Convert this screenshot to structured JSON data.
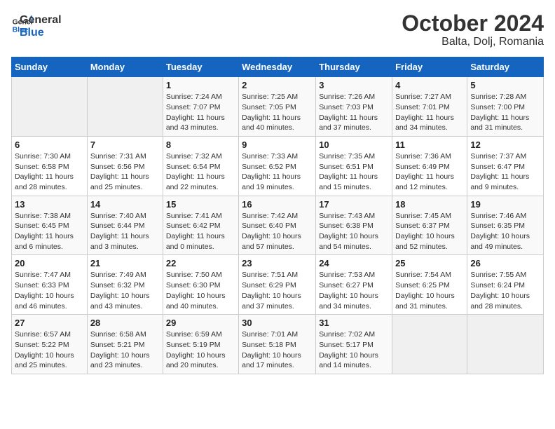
{
  "header": {
    "logo_line1": "General",
    "logo_line2": "Blue",
    "title": "October 2024",
    "subtitle": "Balta, Dolj, Romania"
  },
  "weekdays": [
    "Sunday",
    "Monday",
    "Tuesday",
    "Wednesday",
    "Thursday",
    "Friday",
    "Saturday"
  ],
  "weeks": [
    [
      {
        "day": "",
        "info": ""
      },
      {
        "day": "",
        "info": ""
      },
      {
        "day": "1",
        "info": "Sunrise: 7:24 AM\nSunset: 7:07 PM\nDaylight: 11 hours and 43 minutes."
      },
      {
        "day": "2",
        "info": "Sunrise: 7:25 AM\nSunset: 7:05 PM\nDaylight: 11 hours and 40 minutes."
      },
      {
        "day": "3",
        "info": "Sunrise: 7:26 AM\nSunset: 7:03 PM\nDaylight: 11 hours and 37 minutes."
      },
      {
        "day": "4",
        "info": "Sunrise: 7:27 AM\nSunset: 7:01 PM\nDaylight: 11 hours and 34 minutes."
      },
      {
        "day": "5",
        "info": "Sunrise: 7:28 AM\nSunset: 7:00 PM\nDaylight: 11 hours and 31 minutes."
      }
    ],
    [
      {
        "day": "6",
        "info": "Sunrise: 7:30 AM\nSunset: 6:58 PM\nDaylight: 11 hours and 28 minutes."
      },
      {
        "day": "7",
        "info": "Sunrise: 7:31 AM\nSunset: 6:56 PM\nDaylight: 11 hours and 25 minutes."
      },
      {
        "day": "8",
        "info": "Sunrise: 7:32 AM\nSunset: 6:54 PM\nDaylight: 11 hours and 22 minutes."
      },
      {
        "day": "9",
        "info": "Sunrise: 7:33 AM\nSunset: 6:52 PM\nDaylight: 11 hours and 19 minutes."
      },
      {
        "day": "10",
        "info": "Sunrise: 7:35 AM\nSunset: 6:51 PM\nDaylight: 11 hours and 15 minutes."
      },
      {
        "day": "11",
        "info": "Sunrise: 7:36 AM\nSunset: 6:49 PM\nDaylight: 11 hours and 12 minutes."
      },
      {
        "day": "12",
        "info": "Sunrise: 7:37 AM\nSunset: 6:47 PM\nDaylight: 11 hours and 9 minutes."
      }
    ],
    [
      {
        "day": "13",
        "info": "Sunrise: 7:38 AM\nSunset: 6:45 PM\nDaylight: 11 hours and 6 minutes."
      },
      {
        "day": "14",
        "info": "Sunrise: 7:40 AM\nSunset: 6:44 PM\nDaylight: 11 hours and 3 minutes."
      },
      {
        "day": "15",
        "info": "Sunrise: 7:41 AM\nSunset: 6:42 PM\nDaylight: 11 hours and 0 minutes."
      },
      {
        "day": "16",
        "info": "Sunrise: 7:42 AM\nSunset: 6:40 PM\nDaylight: 10 hours and 57 minutes."
      },
      {
        "day": "17",
        "info": "Sunrise: 7:43 AM\nSunset: 6:38 PM\nDaylight: 10 hours and 54 minutes."
      },
      {
        "day": "18",
        "info": "Sunrise: 7:45 AM\nSunset: 6:37 PM\nDaylight: 10 hours and 52 minutes."
      },
      {
        "day": "19",
        "info": "Sunrise: 7:46 AM\nSunset: 6:35 PM\nDaylight: 10 hours and 49 minutes."
      }
    ],
    [
      {
        "day": "20",
        "info": "Sunrise: 7:47 AM\nSunset: 6:33 PM\nDaylight: 10 hours and 46 minutes."
      },
      {
        "day": "21",
        "info": "Sunrise: 7:49 AM\nSunset: 6:32 PM\nDaylight: 10 hours and 43 minutes."
      },
      {
        "day": "22",
        "info": "Sunrise: 7:50 AM\nSunset: 6:30 PM\nDaylight: 10 hours and 40 minutes."
      },
      {
        "day": "23",
        "info": "Sunrise: 7:51 AM\nSunset: 6:29 PM\nDaylight: 10 hours and 37 minutes."
      },
      {
        "day": "24",
        "info": "Sunrise: 7:53 AM\nSunset: 6:27 PM\nDaylight: 10 hours and 34 minutes."
      },
      {
        "day": "25",
        "info": "Sunrise: 7:54 AM\nSunset: 6:25 PM\nDaylight: 10 hours and 31 minutes."
      },
      {
        "day": "26",
        "info": "Sunrise: 7:55 AM\nSunset: 6:24 PM\nDaylight: 10 hours and 28 minutes."
      }
    ],
    [
      {
        "day": "27",
        "info": "Sunrise: 6:57 AM\nSunset: 5:22 PM\nDaylight: 10 hours and 25 minutes."
      },
      {
        "day": "28",
        "info": "Sunrise: 6:58 AM\nSunset: 5:21 PM\nDaylight: 10 hours and 23 minutes."
      },
      {
        "day": "29",
        "info": "Sunrise: 6:59 AM\nSunset: 5:19 PM\nDaylight: 10 hours and 20 minutes."
      },
      {
        "day": "30",
        "info": "Sunrise: 7:01 AM\nSunset: 5:18 PM\nDaylight: 10 hours and 17 minutes."
      },
      {
        "day": "31",
        "info": "Sunrise: 7:02 AM\nSunset: 5:17 PM\nDaylight: 10 hours and 14 minutes."
      },
      {
        "day": "",
        "info": ""
      },
      {
        "day": "",
        "info": ""
      }
    ]
  ]
}
